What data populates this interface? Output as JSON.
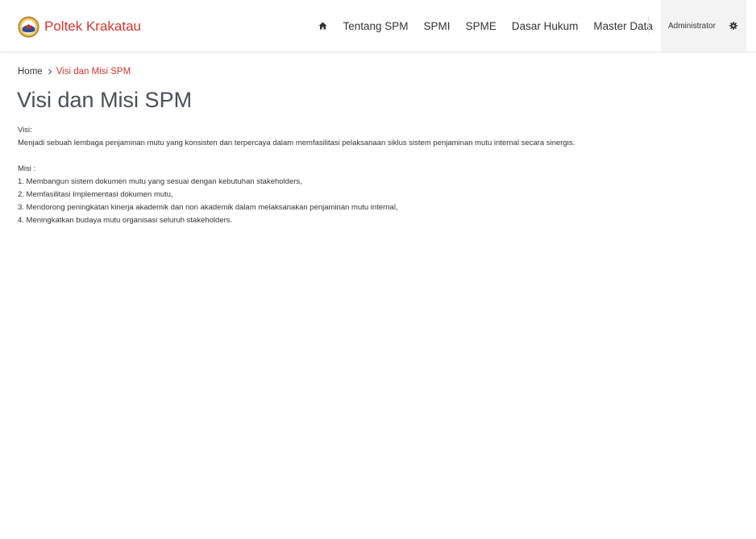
{
  "header": {
    "brand": "Poltek Krakatau",
    "nav": [
      {
        "label": "Tentang SPM"
      },
      {
        "label": "SPMI"
      },
      {
        "label": "SPME"
      },
      {
        "label": "Dasar Hukum"
      },
      {
        "label": "Master Data"
      }
    ],
    "user": "Administrator",
    "icons": {
      "home": "home-icon",
      "settings": "gear-icon",
      "logo": "college-emblem"
    }
  },
  "breadcrumb": {
    "home": "Home",
    "current": "Visi dan Misi SPM"
  },
  "page": {
    "title": "Visi dan Misi SPM",
    "visi_label": "Visi:",
    "visi_text": "Menjadi sebuah lembaga penjaminan mutu yang konsisten dan terpercaya dalam memfasilitasi pelaksanaan siklus sistem penjaminan mutu internal secara sinergis.",
    "misi_label": "Misi :",
    "misi_items": [
      "1. Membangun sistem dokumen mutu yang sesuai dengan kebutuhan stakeholders,",
      "2. Memfasilitasi Implementasi dokumen mutu,",
      "3. Mendorong peningkatan kinerja akademik dan non akademik dalam melaksanakan penjaminan mutu internal,",
      "4. Meningkatkan budaya mutu organisasi seluruh stakeholders."
    ]
  },
  "colors": {
    "brand": "#d9342b",
    "title": "#4a4f57",
    "user_bg": "#f3f3f3"
  }
}
